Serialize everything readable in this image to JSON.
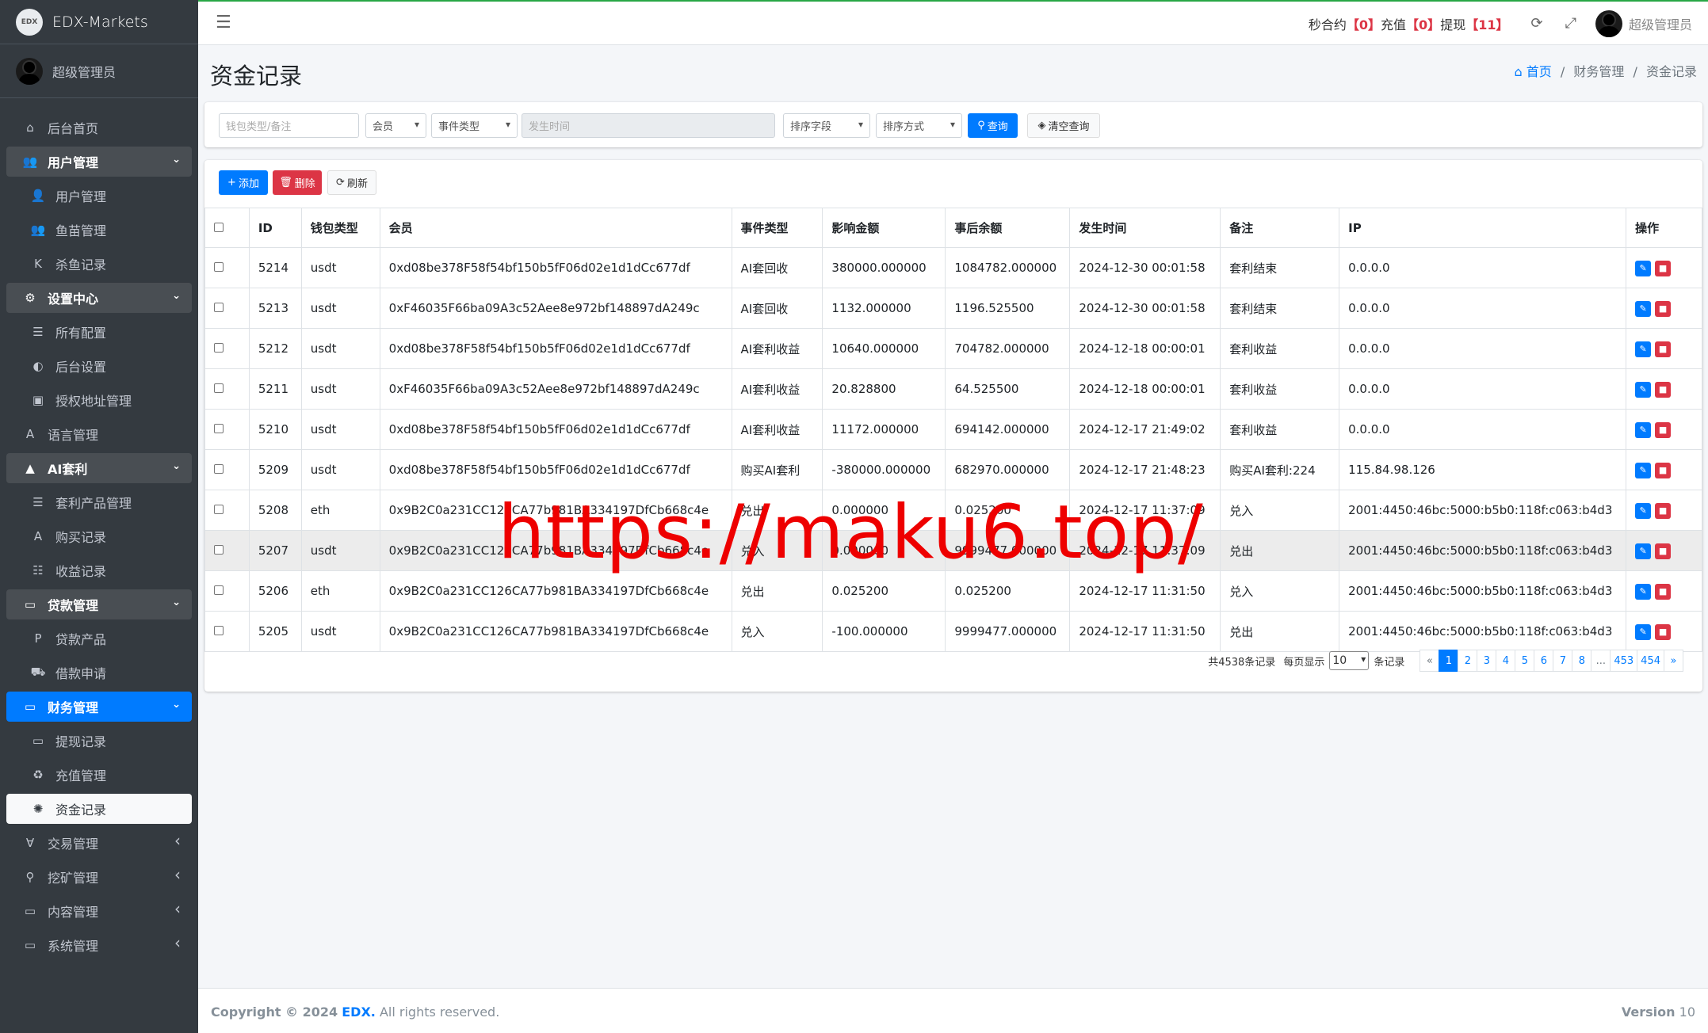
{
  "brand": {
    "logo": "EDX",
    "name": "EDX-Markets"
  },
  "user": {
    "name": "超级管理员"
  },
  "menu": [
    {
      "label": "后台首页",
      "icon": "⌂",
      "type": "top"
    },
    {
      "label": "用户管理",
      "icon": "👥",
      "type": "open"
    },
    {
      "label": "用户管理",
      "icon": "👤",
      "type": "sub"
    },
    {
      "label": "鱼苗管理",
      "icon": "👥",
      "type": "sub"
    },
    {
      "label": "杀鱼记录",
      "icon": "K",
      "type": "sub"
    },
    {
      "label": "设置中心",
      "icon": "⚙",
      "type": "open"
    },
    {
      "label": "所有配置",
      "icon": "☰",
      "type": "sub"
    },
    {
      "label": "后台设置",
      "icon": "◐",
      "type": "sub"
    },
    {
      "label": "授权地址管理",
      "icon": "▣",
      "type": "sub"
    },
    {
      "label": "语言管理",
      "icon": "A",
      "type": "top"
    },
    {
      "label": "AI套利",
      "icon": "▲",
      "type": "open"
    },
    {
      "label": "套利产品管理",
      "icon": "☰",
      "type": "sub"
    },
    {
      "label": "购买记录",
      "icon": "A",
      "type": "sub"
    },
    {
      "label": "收益记录",
      "icon": "☷",
      "type": "sub"
    },
    {
      "label": "贷款管理",
      "icon": "▭",
      "type": "open"
    },
    {
      "label": "贷款产品",
      "icon": "P",
      "type": "sub"
    },
    {
      "label": "借款申请",
      "icon": "⛟",
      "type": "sub"
    },
    {
      "label": "财务管理",
      "icon": "▭",
      "type": "active"
    },
    {
      "label": "提现记录",
      "icon": "▭",
      "type": "sub"
    },
    {
      "label": "充值管理",
      "icon": "♻",
      "type": "sub"
    },
    {
      "label": "资金记录",
      "icon": "✺",
      "type": "current"
    },
    {
      "label": "交易管理",
      "icon": "∀",
      "type": "collapsed"
    },
    {
      "label": "挖矿管理",
      "icon": "⚲",
      "type": "collapsed"
    },
    {
      "label": "内容管理",
      "icon": "▭",
      "type": "collapsed"
    },
    {
      "label": "系统管理",
      "icon": "▭",
      "type": "collapsed"
    }
  ],
  "topbar": {
    "seconds_label": "秒合约",
    "seconds_count": "【0】",
    "recharge_label": "充值",
    "recharge_count": "【0】",
    "withdraw_label": "提现",
    "withdraw_count": "【11】",
    "admin": "超级管理员"
  },
  "page": {
    "title": "资金记录"
  },
  "breadcrumb": {
    "home": "首页",
    "sep": "/",
    "parent": "财务管理",
    "current": "资金记录"
  },
  "filters": {
    "keyword_placeholder": "钱包类型/备注",
    "member": "会员",
    "event_type": "事件类型",
    "time_placeholder": "发生时间",
    "sort_field": "排序字段",
    "sort_order": "排序方式",
    "search_btn": "查询",
    "clear_btn": "清空查询"
  },
  "toolbar": {
    "add": "添加",
    "delete": "删除",
    "refresh": "刷新"
  },
  "table": {
    "headers": [
      "ID",
      "钱包类型",
      "会员",
      "事件类型",
      "影响金额",
      "事后余额",
      "发生时间",
      "备注",
      "IP",
      "操作"
    ],
    "rows": [
      [
        "5214",
        "usdt",
        "0xd08be378F58f54bf150b5fF06d02e1d1dCc677df",
        "AI套回收",
        "380000.000000",
        "1084782.000000",
        "2024-12-30 00:01:58",
        "套利结束",
        "0.0.0.0"
      ],
      [
        "5213",
        "usdt",
        "0xF46035F66ba09A3c52Aee8e972bf148897dA249c",
        "AI套回收",
        "1132.000000",
        "1196.525500",
        "2024-12-30 00:01:58",
        "套利结束",
        "0.0.0.0"
      ],
      [
        "5212",
        "usdt",
        "0xd08be378F58f54bf150b5fF06d02e1d1dCc677df",
        "AI套利收益",
        "10640.000000",
        "704782.000000",
        "2024-12-18 00:00:01",
        "套利收益",
        "0.0.0.0"
      ],
      [
        "5211",
        "usdt",
        "0xF46035F66ba09A3c52Aee8e972bf148897dA249c",
        "AI套利收益",
        "20.828800",
        "64.525500",
        "2024-12-18 00:00:01",
        "套利收益",
        "0.0.0.0"
      ],
      [
        "5210",
        "usdt",
        "0xd08be378F58f54bf150b5fF06d02e1d1dCc677df",
        "AI套利收益",
        "11172.000000",
        "694142.000000",
        "2024-12-17 21:49:02",
        "套利收益",
        "0.0.0.0"
      ],
      [
        "5209",
        "usdt",
        "0xd08be378F58f54bf150b5fF06d02e1d1dCc677df",
        "购买AI套利",
        "-380000.000000",
        "682970.000000",
        "2024-12-17 21:48:23",
        "购买AI套利:224",
        "115.84.98.126"
      ],
      [
        "5208",
        "eth",
        "0x9B2C0a231CC126CA77b981BA334197DfCb668c4e",
        "兑出",
        "0.000000",
        "0.025200",
        "2024-12-17 11:37:09",
        "兑入",
        "2001:4450:46bc:5000:b5b0:118f:c063:b4d3"
      ],
      [
        "5207",
        "usdt",
        "0x9B2C0a231CC126CA77b981BA334197DfCb668c4e",
        "兑入",
        "0.000000",
        "9999477.000000",
        "2024-12-17 11:37:09",
        "兑出",
        "2001:4450:46bc:5000:b5b0:118f:c063:b4d3"
      ],
      [
        "5206",
        "eth",
        "0x9B2C0a231CC126CA77b981BA334197DfCb668c4e",
        "兑出",
        "0.025200",
        "0.025200",
        "2024-12-17 11:31:50",
        "兑入",
        "2001:4450:46bc:5000:b5b0:118f:c063:b4d3"
      ],
      [
        "5205",
        "usdt",
        "0x9B2C0a231CC126CA77b981BA334197DfCb668c4e",
        "兑入",
        "-100.000000",
        "9999477.000000",
        "2024-12-17 11:31:50",
        "兑出",
        "2001:4450:46bc:5000:b5b0:118f:c063:b4d3"
      ]
    ]
  },
  "pagination": {
    "total_text": "共4538条记录",
    "per_page_label": "每页显示",
    "per_page": "10",
    "per_page_suffix": "条记录",
    "pages": [
      "«",
      "1",
      "2",
      "3",
      "4",
      "5",
      "6",
      "7",
      "8",
      "...",
      "453",
      "454",
      "»"
    ],
    "current": "1"
  },
  "footer": {
    "copyright": "Copyright © 2024",
    "brand": "EDX.",
    "rights": "All rights reserved.",
    "version_label": "Version",
    "version": "10"
  },
  "watermark": "https://maku6.top/",
  "colors": {
    "primary": "#007bff",
    "danger": "#dc3545",
    "sidebar": "#343a40",
    "top_accent": "#28a745"
  }
}
